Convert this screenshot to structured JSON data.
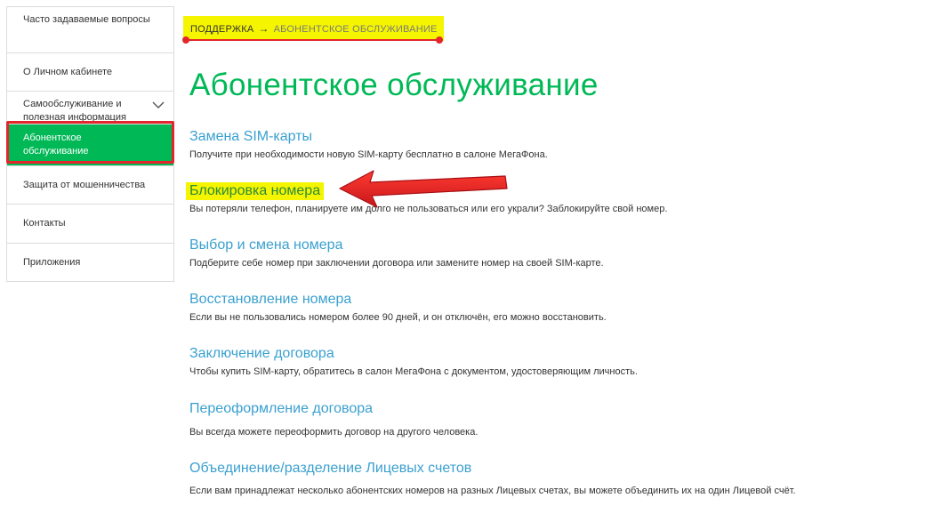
{
  "sidebar": {
    "items": [
      {
        "label": "Часто задаваемые вопросы"
      },
      {
        "label": "О Личном кабинете"
      },
      {
        "label": "Самообслуживание и полезная информация"
      },
      {
        "label": "Абонентское обслуживание"
      },
      {
        "label": "Защита от мошенничества"
      },
      {
        "label": "Контакты"
      },
      {
        "label": "Приложения"
      }
    ]
  },
  "breadcrumb": {
    "home": "ПОДДЕРЖКА",
    "separator": "→",
    "current": "АБОНЕНТСКОЕ ОБСЛУЖИВАНИЕ"
  },
  "page": {
    "title": "Абонентское обслуживание"
  },
  "sections": [
    {
      "title": "Замена SIM-карты",
      "description": "Получите при необходимости новую SIM-карту бесплатно в салоне МегаФона."
    },
    {
      "title": "Блокировка номера",
      "description": "Вы потеряли телефон, планируете им долго не пользоваться или его украли? Заблокируйте свой номер."
    },
    {
      "title": "Выбор и смена номера",
      "description": "Подберите себе номер при заключении договора или замените номер на своей SIM-карте."
    },
    {
      "title": "Восстановление номера",
      "description": "Если вы не пользовались номером более 90 дней, и он отключён, его можно восстановить."
    },
    {
      "title": "Заключение договора",
      "description": "Чтобы купить SIM-карту, обратитесь в салон МегаФона с документом, удостоверяющим личность."
    },
    {
      "title": "Переоформление договора",
      "description": "Вы всегда можете переоформить договор на другого человека."
    },
    {
      "title": "Объединение/разделение Лицевых счетов",
      "description": "Если вам принадлежат несколько абонентских номеров на разных Лицевых счетах, вы можете объединить их на один Лицевой счёт."
    }
  ],
  "colors": {
    "brand_green": "#00b956",
    "link_blue": "#3aa0d0",
    "highlight_yellow": "#f5f500",
    "annotation_red": "#e3262b"
  },
  "icons": {
    "sidebar_expand": "chevron-down-icon",
    "annotation": "red-arrow-annotation"
  }
}
